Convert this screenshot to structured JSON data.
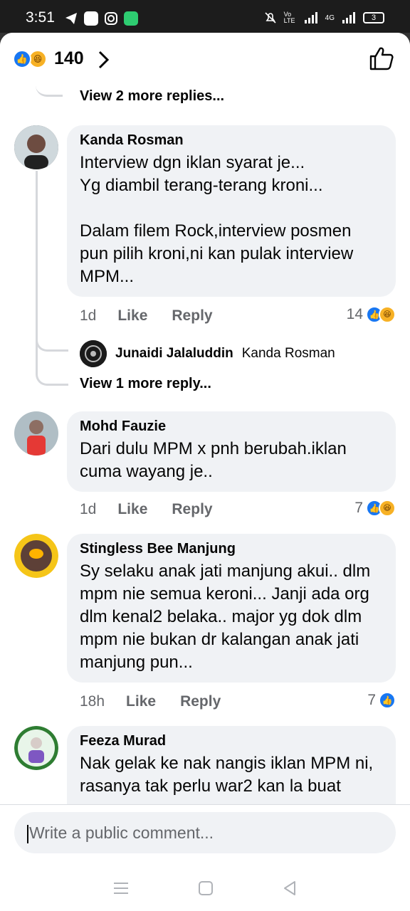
{
  "status": {
    "time": "3:51",
    "battery": "3",
    "net_a": "Vo LTE",
    "net_b": "4G"
  },
  "header": {
    "reaction_count": "140"
  },
  "feed": {
    "view_more_top": "View 2 more replies...",
    "comments": [
      {
        "name": "Kanda Rosman",
        "text": "Interview dgn iklan syarat je...\nYg diambil terang-terang kroni...\n\nDalam filem Rock,interview posmen pun pilih kroni,ni kan pulak interview MPM...",
        "time": "1d",
        "like": "Like",
        "reply": "Reply",
        "reactions": "14"
      },
      {
        "name": "Mohd Fauzie",
        "text": "Dari dulu MPM x pnh berubah.iklan cuma wayang je..",
        "time": "1d",
        "like": "Like",
        "reply": "Reply",
        "reactions": "7"
      },
      {
        "name": "Stingless Bee Manjung",
        "text": "Sy selaku anak jati manjung akui.. dlm mpm nie semua keroni... Janji ada org dlm kenal2 belaka.. major yg dok dlm mpm nie bukan dr kalangan anak jati manjung pun...",
        "time": "18h",
        "like": "Like",
        "reply": "Reply",
        "reactions": "7"
      },
      {
        "name": "Feeza Murad",
        "text": "Nak gelak ke nak nangis iklan MPM ni, rasanya tak perlu war2 kan la buat"
      }
    ],
    "nested_reply": {
      "name": "Junaidi Jalaluddin",
      "tag": "Kanda Rosman"
    },
    "view_more_nested": "View 1 more reply..."
  },
  "composer": {
    "placeholder": "Write a public comment..."
  }
}
